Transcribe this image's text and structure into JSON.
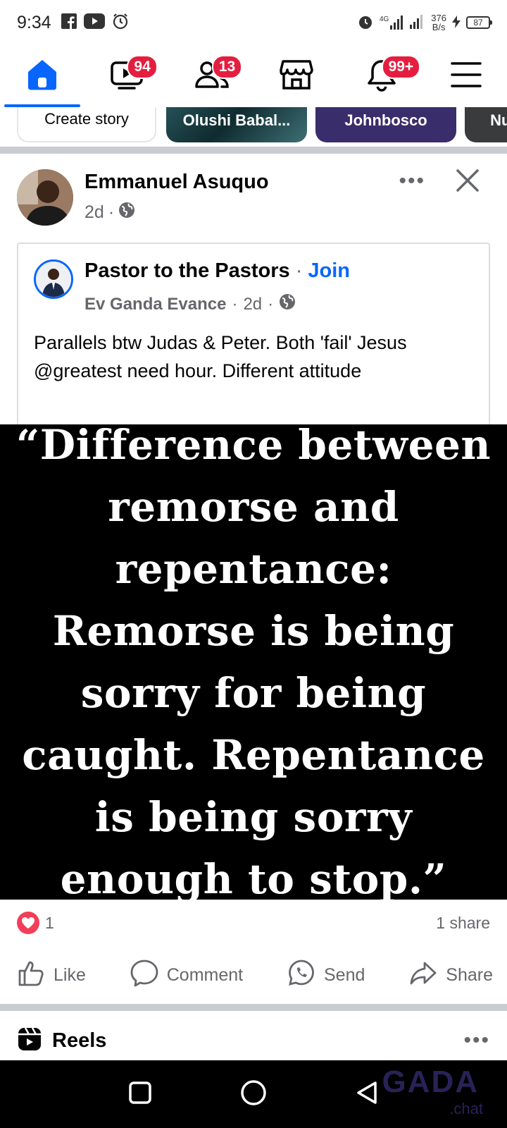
{
  "status_bar": {
    "time": "9:34",
    "network": "4G",
    "speed_value": "376",
    "speed_unit": "B/s",
    "battery": "87"
  },
  "top_nav": {
    "badges": {
      "video": "94",
      "friends": "13",
      "notifications": "99+"
    }
  },
  "stories": {
    "items": [
      "Create story",
      "Olushi Babal...",
      "Johnbosco",
      "Nule"
    ]
  },
  "post": {
    "author": "Emmanuel Asuquo",
    "time": "2d",
    "more_label": "•••",
    "shared": {
      "group_name": "Pastor to the Pastors",
      "join_label": "Join",
      "poster": "Ev Ganda Evance",
      "time": "2d",
      "text": "Parallels btw Judas & Peter. Both 'fail' Jesus @greatest need hour. Different attitude"
    },
    "image_quote": "“Difference between remorse and repentance: Remorse is being sorry for being caught. Repentance is being sorry enough to stop.”",
    "reaction_count": "1",
    "share_count": "1 share",
    "actions": {
      "like": "Like",
      "comment": "Comment",
      "send": "Send",
      "share": "Share"
    }
  },
  "reels": {
    "title": "Reels",
    "more_label": "•••"
  },
  "watermark": {
    "brand": "GADA",
    "sub": ".chat"
  },
  "colors": {
    "accent": "#0866ff",
    "badge": "#e41e3f",
    "love": "#f33e58"
  }
}
